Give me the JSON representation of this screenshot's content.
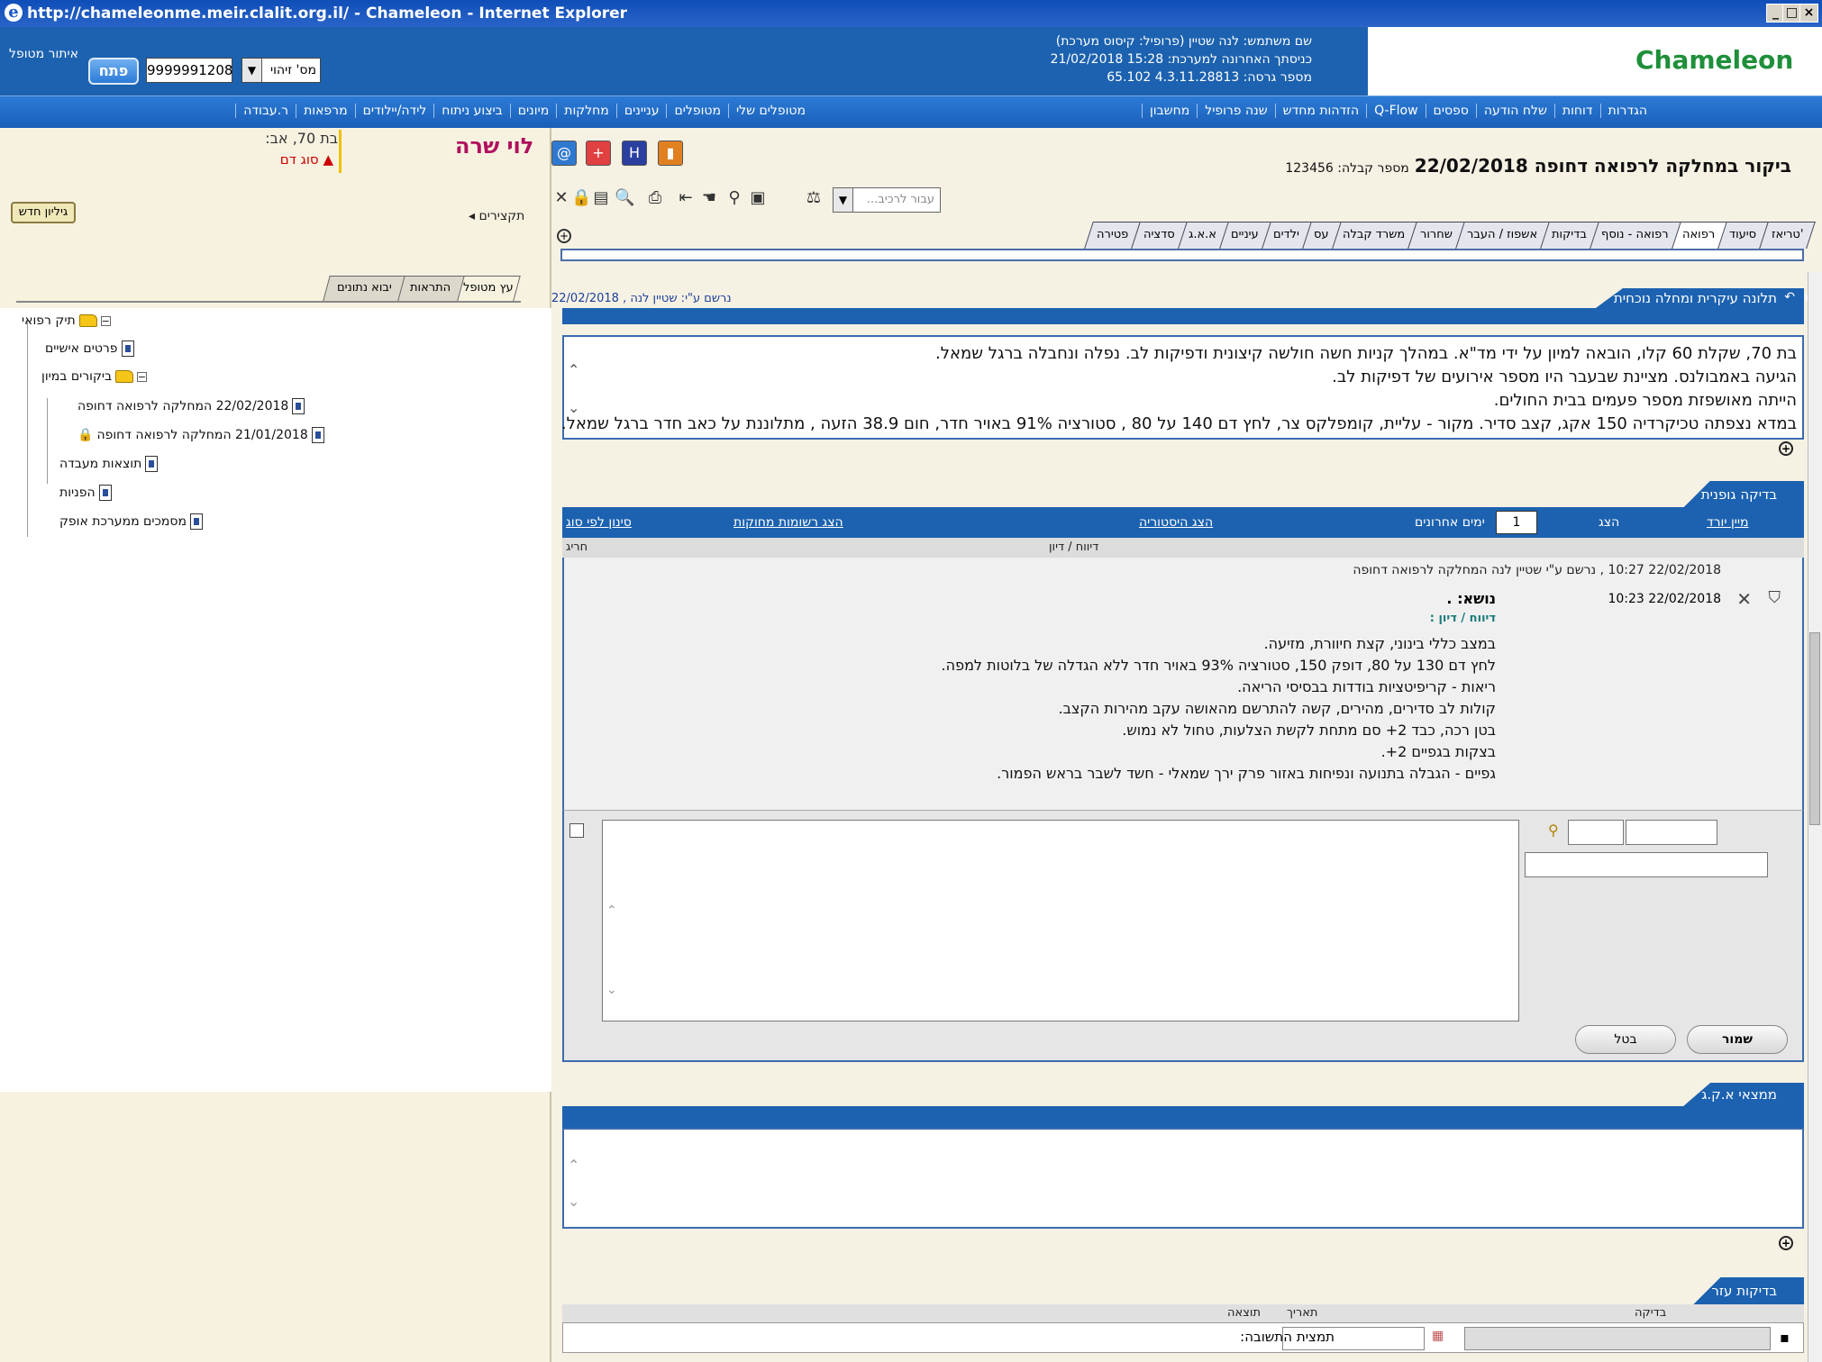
{
  "window": {
    "title": "http://chameleonme.meir.clalit.org.il/ - Chameleon - Internet Explorer",
    "min_icon": "minimize-icon",
    "max_icon": "maximize-icon",
    "close_icon": "close-icon"
  },
  "header": {
    "logo": "Chameleon",
    "user_line": "שם משתמש: לנה שטיין (פרופיל: קיסוס מערכת)",
    "last_login": "כניסתך האחרונה למערכת: 15:28 21/02/2018",
    "version": "מספר גרסה: 4.3.11.28813   65.102",
    "id_type": "מס' זיהוי",
    "id_number": "9999991208",
    "open_button": "פתח",
    "locate": "איתור מטופל"
  },
  "nav": {
    "right_group": [
      "הגדרות",
      "דוחות",
      "שלח הודעה",
      "ספסים",
      "Q-Flow",
      "הזדהות מחדש",
      "שנה פרופיל",
      "מחשבון"
    ],
    "left_group": [
      "מטופלים שלי",
      "מטופלים",
      "עניינים",
      "מחלקות",
      "מיונים",
      "ביצוע ניתוח",
      "לידה/יילודים",
      "מרפאות",
      "ר.עבודה"
    ]
  },
  "patient": {
    "name": "לוי שרה",
    "age": "בת 70, אב:",
    "blood": "סוג דם",
    "new_sheet": "גיליון חדש",
    "summaries": "תקצירים",
    "tabs": [
      "עץ מטופל",
      "התראות",
      "יבוא נתונים"
    ],
    "tree": {
      "root": "תיק רפואי",
      "personal": "פרטים אישיים",
      "visits": "ביקורים במיון",
      "visit1": "22/02/2018 המחלקה לרפואה דחופה",
      "visit2": "21/01/2018 המחלקה לרפואה דחופה",
      "lab": "תוצאות מעבדה",
      "referrals": "הפניות",
      "docs": "מסמכים ממערכת אופק"
    }
  },
  "visit": {
    "title": "ביקור במחלקה לרפואה דחופה 22/02/2018",
    "receipt": "מספר קבלה: 123456",
    "to_subtree": "עבור לרכיב...",
    "tabs": [
      "טריאז'",
      "סיעוד",
      "רפואה",
      "רפואה - נוסף",
      "בדיקות",
      "אשפוז / העבר",
      "שחרור",
      "משרד קבלה",
      "עס",
      "ילדים",
      "עיניים",
      "א.א.ג",
      "סדציה",
      "פטירה"
    ]
  },
  "complaint": {
    "header": "תלונה עיקרית ומחלה נוכחית",
    "recorded_by": "נרשם ע\"י: שטיין לנה , 22/02/2018",
    "lines": [
      "בת 70, שקלת 60 קלו, הובאה למיון על ידי מד\"א. במהלך קניות חשה חולשה קיצונית ודפיקות לב. נפלה ונחבלה ברגל שמאל.",
      "הגיעה באמבולנס. מציינת שבעבר היו מספר אירועים של דפיקות לב.",
      "הייתה מאושפזת מספר פעמים בבית החולים.",
      "במדא נצפתה טכיקרדיה 150 אקג, קצב סדיר. מקור - עליית, קומפלקס צר, לחץ דם 140 על 80 , סטורציה 91% באויר חדר, חום 38.9 הזעה , מתלוננת על כאב חדר ברגל שמאל."
    ]
  },
  "exam": {
    "header": "בדיקה גופנית",
    "sort_date": "מיין יורד",
    "show": "הצג",
    "days_value": "1",
    "days_label": "ימים אחרונים",
    "history": "הצג היסטוריה",
    "deleted": "הצג רשומות מחוקות",
    "filter_type": "סינון לפי סוג",
    "col_text": "דיווח / דיון",
    "col_sev": "חריג",
    "entry_meta": "22/02/2018 10:27 , נרשם ע\"י שטיין לנה המחלקה לרפואה דחופה",
    "entry_time": "22/02/2018   10:23",
    "subject": "נושא: .",
    "discussion_label": "דיווח / דיון :",
    "lines": [
      "במצב כללי בינוני, קצת חיוורת, מזיעה.",
      "לחץ דם 130 על 80, דופק 150, סטורציה 93% באויר חדר ללא הגדלה של בלוטות למפה.",
      "ריאות - קריפיטציות בודדות בבסיסי הריאה.",
      "קולות לב סדירים, מהירים, קשה להתרשם מהאושה עקב מהירות הקצב.",
      "בטן רכה, כבד 2+ סם מתחת לקשת הצלעות, טחול לא נמוש.",
      "בצקות בגפיים 2+.",
      "גפיים - הגבלה בתנועה ונפיחות באזור פרק ירך שמאלי - חשד לשבר בראש הפמור."
    ],
    "save": "שמור",
    "cancel": "בטל"
  },
  "ecg": {
    "header": "ממצאי א.ק.ג"
  },
  "tests": {
    "header": "בדיקות עזר",
    "col_test": "בדיקה",
    "col_date": "תאריך",
    "col_result": "תוצאה",
    "answer_template": "תמצית התשובה:"
  }
}
